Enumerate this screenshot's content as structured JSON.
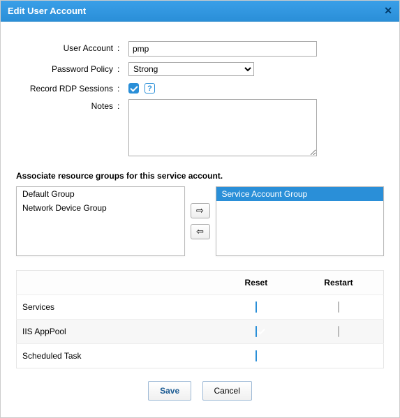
{
  "dialog": {
    "title": "Edit User Account"
  },
  "form": {
    "user_account_label": "User Account",
    "user_account_value": "pmp",
    "password_policy_label": "Password Policy",
    "password_policy_value": "Strong",
    "record_rdp_label": "Record RDP Sessions",
    "notes_label": "Notes",
    "notes_value": ""
  },
  "assoc": {
    "heading": "Associate resource groups for this service account.",
    "left": [
      "Default Group",
      "Network Device Group"
    ],
    "right": [
      "Service Account Group"
    ]
  },
  "table": {
    "col_reset": "Reset",
    "col_restart": "Restart",
    "rows": [
      {
        "name": "Services",
        "reset": true,
        "restart": false
      },
      {
        "name": "IIS AppPool",
        "reset": true,
        "restart": false
      },
      {
        "name": "Scheduled Task",
        "reset": true,
        "restart": null
      }
    ]
  },
  "buttons": {
    "save": "Save",
    "cancel": "Cancel"
  }
}
